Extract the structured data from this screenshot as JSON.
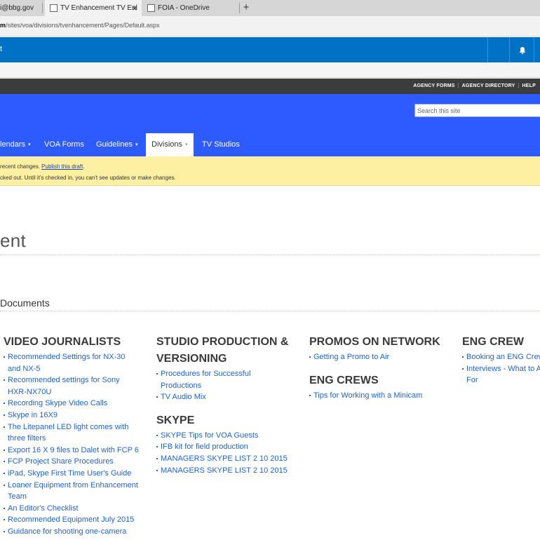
{
  "browser": {
    "tabs": [
      {
        "label": "i@bbg.gov"
      },
      {
        "label": "TV Enhancement TV Enl"
      },
      {
        "label": "FOIA - OneDrive"
      }
    ],
    "close_glyph": "×",
    "new_tab_glyph": "+",
    "url_host": "m",
    "url_path": "/sites/voa/divisions/tvenhancement/Pages/Default.aspx"
  },
  "suitebar": {
    "left_glyph": "t",
    "notification_icon": "bell-icon"
  },
  "topbar": {
    "links": [
      "AGENCY FORMS",
      "AGENCY DIRECTORY",
      "HELP"
    ],
    "separator": "|"
  },
  "search": {
    "placeholder": "Search this site"
  },
  "nav": {
    "items": [
      {
        "label": "lendars",
        "has_caret": true
      },
      {
        "label": "VOA Forms",
        "has_caret": false
      },
      {
        "label": "Guidelines",
        "has_caret": true
      },
      {
        "label": "Divisions",
        "has_caret": true
      },
      {
        "label": "TV Studios",
        "has_caret": false
      }
    ],
    "caret_glyph": "▾"
  },
  "notice": {
    "line1_prefix": "recent changes.",
    "line1_link": "Publish this draft",
    "line1_suffix": ".",
    "line2": "cked out. Until it's checked in, you can't see updates or make changes."
  },
  "page": {
    "title": "ent",
    "section_heading": "Documents"
  },
  "columns": [
    {
      "heading": "VIDEO JOURNALISTS",
      "links": [
        "Recommended Settings for NX-30",
        "and NX-5",
        "Recommended settings for Sony",
        "HXR-NX70U",
        "Recording Skype Video Calls",
        "Skype in 16X9",
        "The Litepanel LED light comes with",
        "three filters",
        "Export 16 X 9 files to Dalet with FCP 6",
        "FCP Project Share Procedures",
        "iPad, Skype First Time User's Guide",
        "Loaner Equipment from Enhancement",
        "Team",
        "An Editor's Checklist",
        "Recommended Equipment July 2015",
        "Guidance for shooting one-camera"
      ],
      "bulleted": [
        true,
        false,
        true,
        false,
        true,
        true,
        true,
        false,
        true,
        true,
        true,
        true,
        false,
        true,
        true,
        true
      ]
    },
    {
      "heading_lines": [
        "STUDIO PRODUCTION &",
        "VERSIONING"
      ],
      "links": [
        "Procedures for Successful",
        "Productions",
        "TV Audio Mix"
      ],
      "bulleted": [
        true,
        false,
        true
      ],
      "heading2": "SKYPE",
      "links2": [
        "SKYPE Tips for VOA Guests",
        "IFB kit for field production",
        "MANAGERS SKYPE LIST 2 10 2015",
        "MANAGERS SKYPE LIST 2 10 2015"
      ]
    },
    {
      "heading": "PROMOS ON NETWORK",
      "links": [
        "Getting a Promo to Air"
      ],
      "heading2": "ENG CREWS",
      "links2": [
        "Tips for Working with a Minicam"
      ]
    },
    {
      "heading": "ENG CREW",
      "links": [
        "Booking an ENG Crew",
        "Interviews - What to A",
        "For"
      ],
      "bulleted": [
        true,
        true,
        false
      ]
    }
  ],
  "colors": {
    "suitebar": "#0072c6",
    "banner": "#2d5bff",
    "notice": "#fdf0a2",
    "link": "#1e63d6"
  }
}
